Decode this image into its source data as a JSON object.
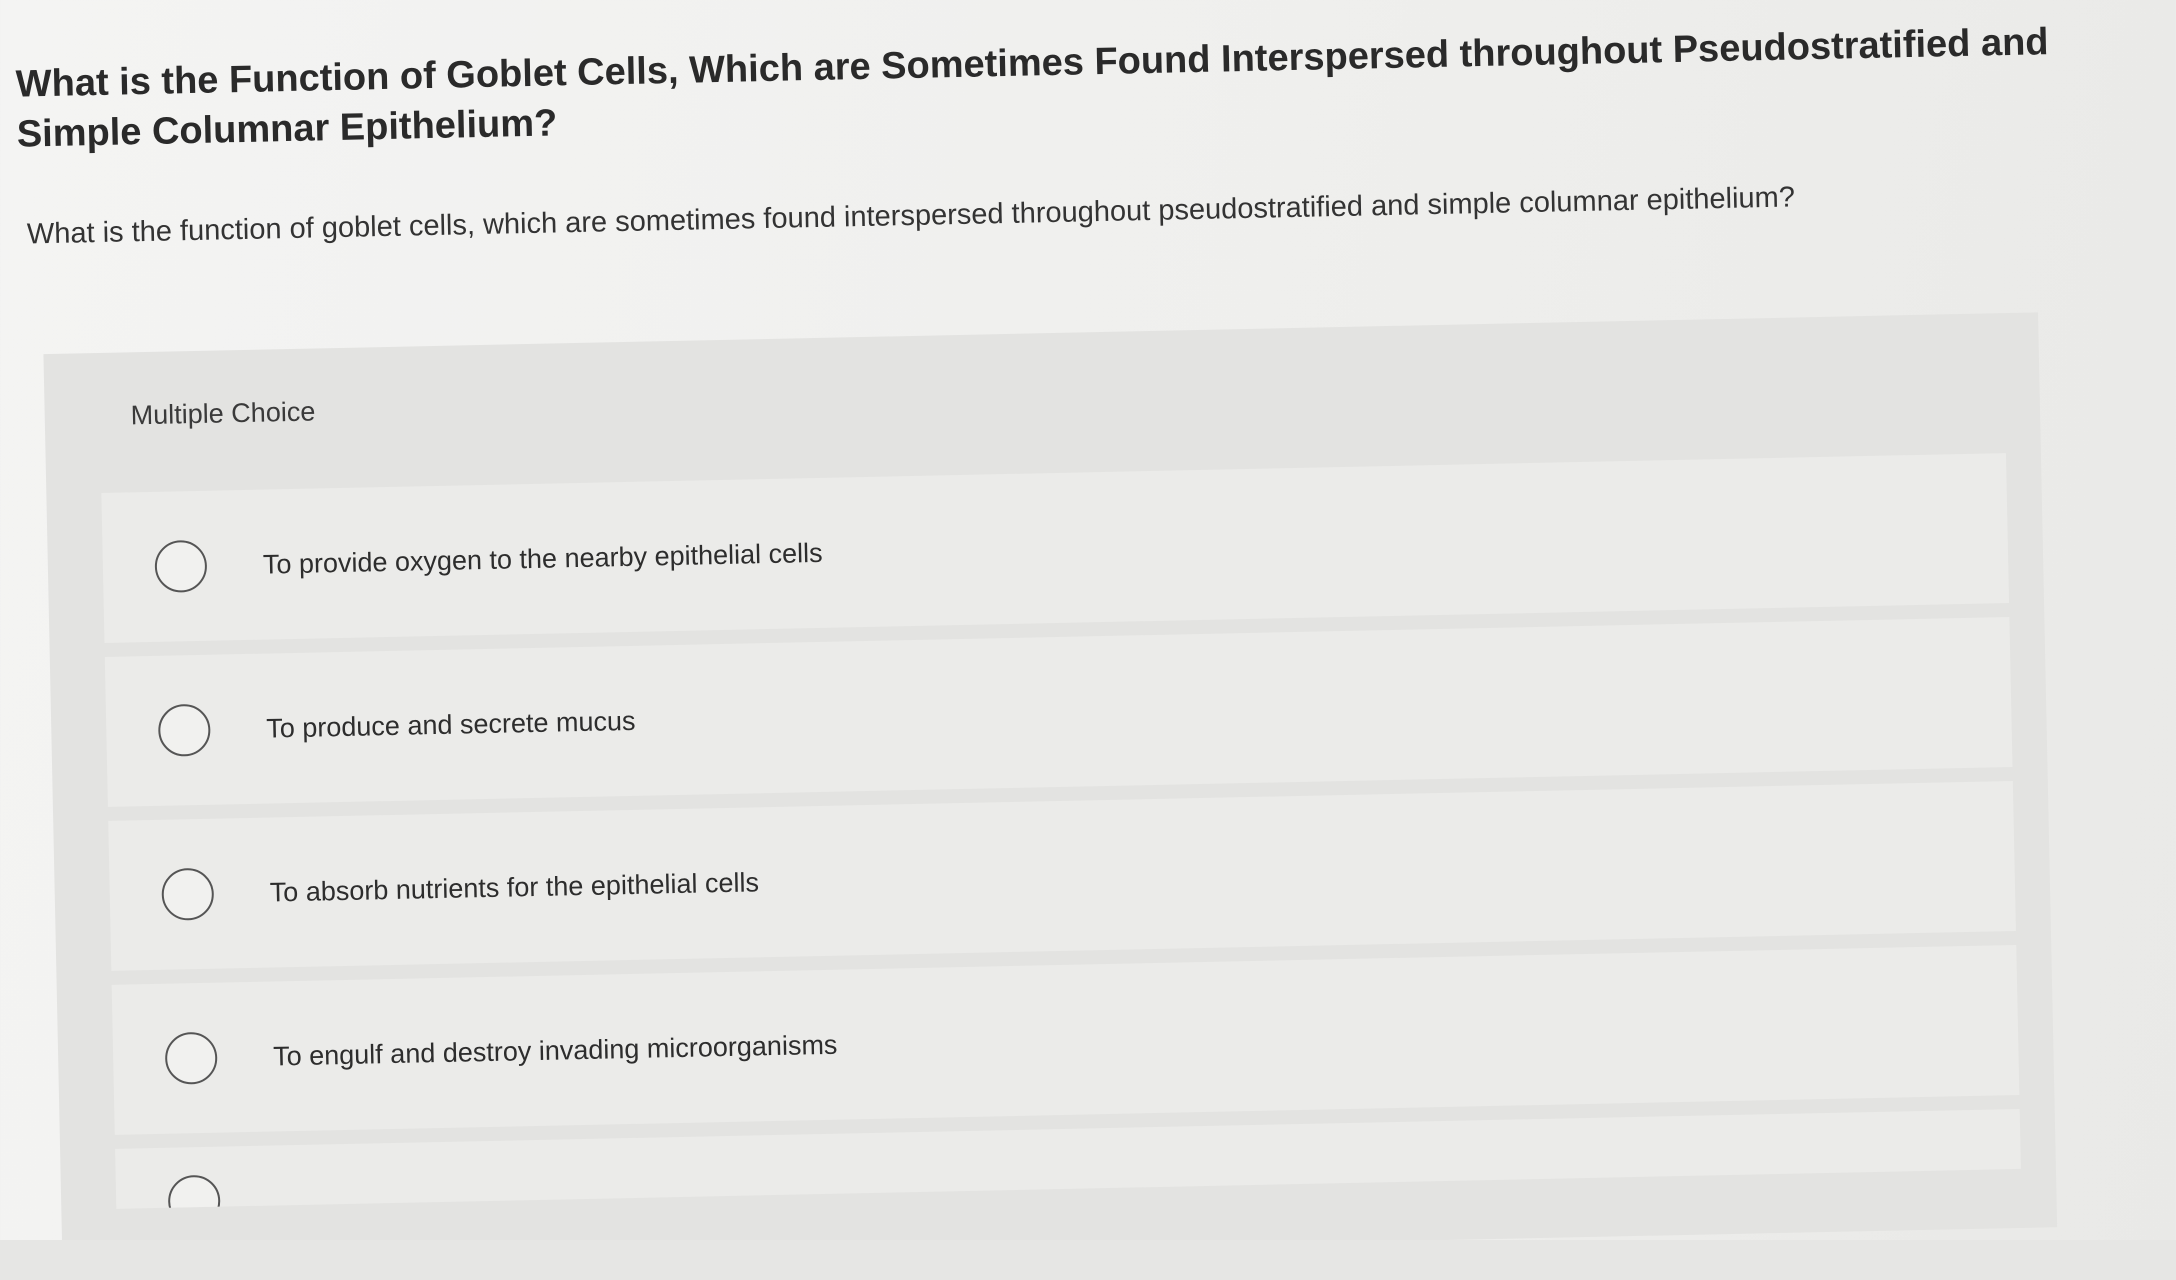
{
  "question": {
    "title": "What is the Function of Goblet Cells, Which are Sometimes Found Interspersed throughout Pseudostratified and Simple Columnar Epithelium?",
    "body": "What is the function of goblet cells, which are sometimes found interspersed throughout pseudostratified and simple columnar epithelium?"
  },
  "multiple_choice": {
    "label": "Multiple Choice",
    "options": [
      {
        "label": "To provide oxygen to the nearby epithelial cells"
      },
      {
        "label": "To produce and secrete mucus"
      },
      {
        "label": "To absorb nutrients for the epithelial cells"
      },
      {
        "label": "To engulf and destroy invading microorganisms"
      }
    ]
  },
  "colors": {
    "page_background": "#efefed",
    "panel_background": "#e3e3e1",
    "option_background": "#ebebe9",
    "text": "#2b2b2b",
    "radio_border": "#555555"
  }
}
